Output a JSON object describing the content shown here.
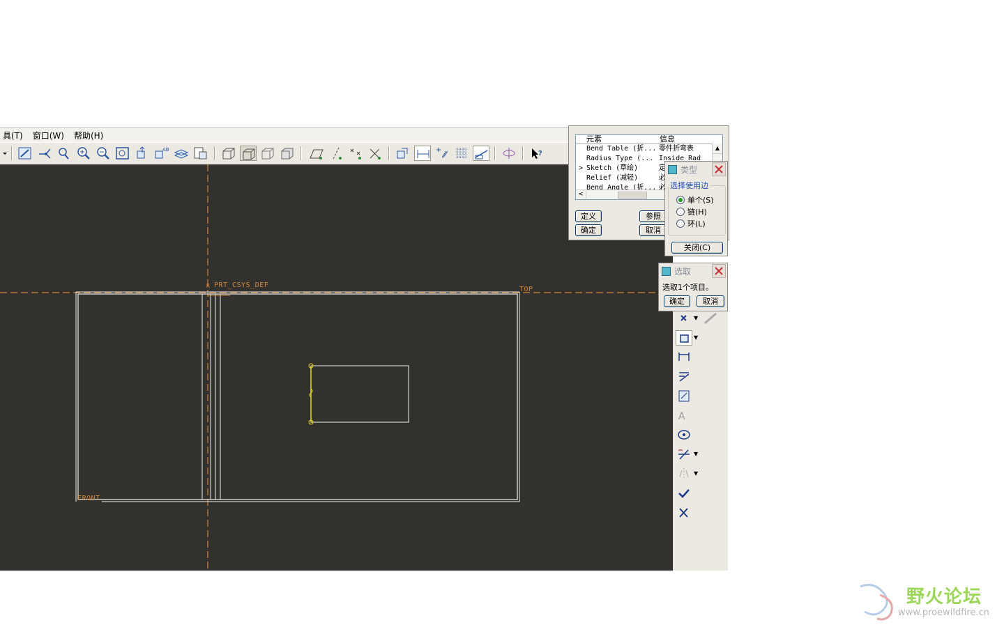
{
  "menubar": {
    "items": [
      "具(T)",
      "窗口(W)",
      "帮助(H)"
    ]
  },
  "toolbar": {
    "icons": [
      "sketch-icon",
      "datum-point-icon",
      "analysis-icon",
      "zoom-in-icon",
      "zoom-out-icon",
      "refit-icon",
      "orient-icon",
      "named-view-icon",
      "layer-icon",
      "view-manager-icon",
      "wireframe-icon",
      "hidden-line-icon",
      "no-hidden-icon",
      "shaded-icon",
      "datum-plane-toggle-icon",
      "datum-axis-toggle-icon",
      "point-toggle-icon",
      "csys-toggle-icon",
      "sketch-reference-icon",
      "dimension-icon",
      "constraint-icon",
      "grid-icon",
      "sketch-view-icon",
      "spin-center-icon",
      "whats-this-icon"
    ]
  },
  "canvas": {
    "background": "#33312e",
    "datum_color": "#d0873a",
    "labels": {
      "csys": "PRT_CSYS_DEF",
      "csys_prefix": "R",
      "top": "TOP",
      "front": "FRONT"
    }
  },
  "element_dialog": {
    "col_element": "元素",
    "col_info": "信息",
    "rows": [
      {
        "marker": "",
        "element": "Bend Table (折...",
        "info": "零件折弯表"
      },
      {
        "marker": "",
        "element": "Radius Type (...",
        "info": "Inside Rad"
      },
      {
        "marker": ">",
        "element": "Sketch (草绘)",
        "info": "定义"
      },
      {
        "marker": "",
        "element": "Relief (减轻)",
        "info": "必"
      },
      {
        "marker": "",
        "element": "Bend Angle (折...",
        "info": "必"
      }
    ],
    "buttons": {
      "define": "定义",
      "refs": "参照",
      "ok": "确定",
      "cancel": "取消"
    }
  },
  "type_dialog": {
    "title": "类型",
    "group_label": "选择使用边",
    "options": [
      {
        "label": "单个(S)",
        "selected": true
      },
      {
        "label": "链(H)",
        "selected": false
      },
      {
        "label": "环(L)",
        "selected": false
      }
    ],
    "close_label": "关闭(C)"
  },
  "select_dialog": {
    "title": "选取",
    "message": "选取1个项目。",
    "ok": "确定",
    "cancel": "取消"
  },
  "right_toolbar": {
    "icons": [
      "delete-icon",
      "link-icon",
      "rectangle-icon",
      "normal-dimension-icon",
      "constrain-icon",
      "modify-icon",
      "text-icon",
      "palette-icon",
      "trim-icon",
      "mirror-icon",
      "accept-icon",
      "cancel-icon"
    ]
  },
  "watermark": {
    "title": "野火论坛",
    "url": "www.proewildfire.cn"
  }
}
